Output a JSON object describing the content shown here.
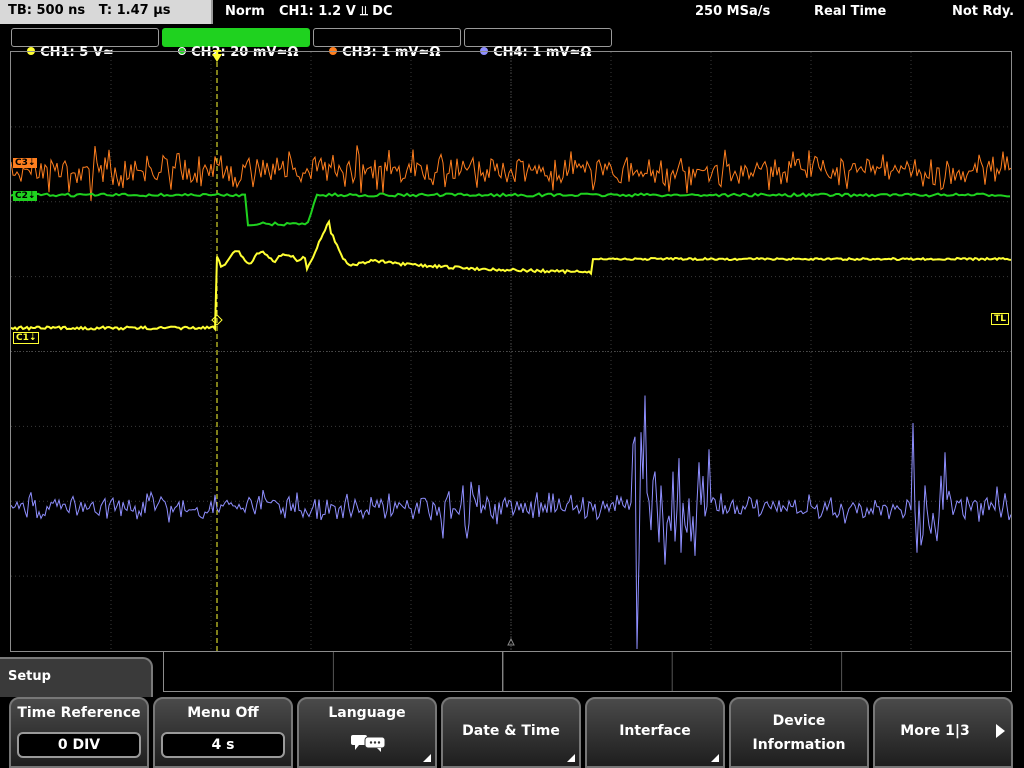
{
  "header": {
    "timebase": "TB: 500 ns   T: 1.47 µs",
    "mode": "Norm",
    "trigger": "CH1: 1.2 V ⫫ DC",
    "sample_rate": "250 MSa/s",
    "acq": "Real Time",
    "status": "Not Rdy."
  },
  "channels": [
    {
      "label": "CH1: 5 V≃",
      "color": "#ffff33",
      "active": false
    },
    {
      "label": "CH2: 20 mV≃Ω",
      "color": "#1fd21f",
      "active": true
    },
    {
      "label": "CH3: 1 mV≃Ω",
      "color": "#ff7f1f",
      "active": false
    },
    {
      "label": "CH4: 1 mV≃Ω",
      "color": "#8f8fff",
      "active": false
    }
  ],
  "markers": {
    "c1": "C1⇣",
    "c2": "C2⇣",
    "c3": "C3⇣",
    "trigger_level": "TL",
    "trigger_pos": "T"
  },
  "menu": {
    "title": "Setup",
    "time_reference": {
      "label": "Time Reference",
      "value": "0 DIV"
    },
    "menu_off": {
      "label": "Menu Off",
      "value": "4 s"
    },
    "language": {
      "label": "Language",
      "icon": "speech-bubbles-icon"
    },
    "date_time": {
      "label": "Date & Time"
    },
    "interface": {
      "label": "Interface"
    },
    "device_info": {
      "label1": "Device",
      "label2": "Information"
    },
    "more": {
      "label": "More 1|3"
    }
  }
}
